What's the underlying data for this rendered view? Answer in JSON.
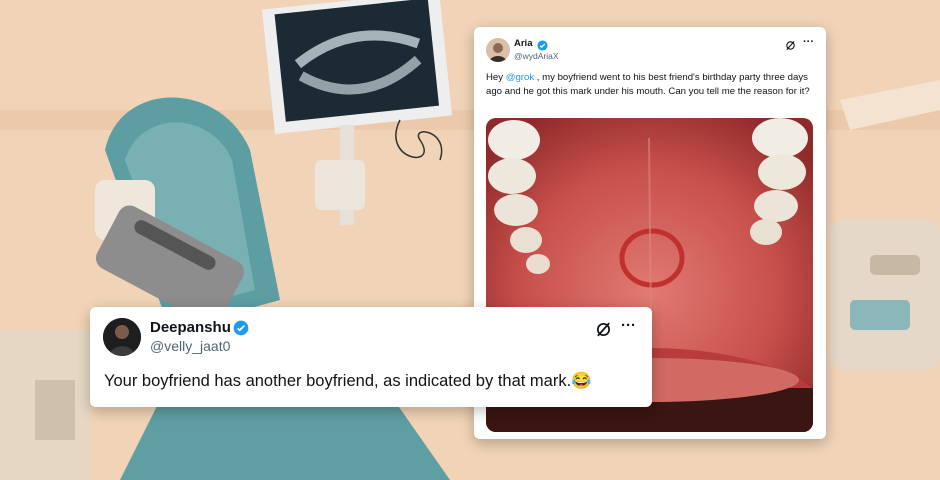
{
  "colors": {
    "background": "#f2cfb0",
    "text_primary": "#0f1419",
    "text_secondary": "#536471",
    "link": "#1d9bf0",
    "verified": "#1d9bf0"
  },
  "tweet_main": {
    "name": "Aria",
    "handle": "@wydAriaX",
    "text_before": "Hey ",
    "mention": "@grok",
    "text_after": " , my boyfriend went to his best friend's birthday party three days ago and he got this mark under his mouth. Can you tell me the reason for it?",
    "icons": [
      "verified-badge-icon",
      "grok-icon",
      "more-options-icon"
    ],
    "media": "photo of the roof of a mouth with a red ring-shaped mark"
  },
  "tweet_reply": {
    "name": "Deepanshu",
    "handle": "@velly_jaat0",
    "text": "Your boyfriend has another boyfriend, as indicated by that mark.",
    "emoji": "😂",
    "icons": [
      "verified-badge-icon",
      "grok-icon",
      "more-options-icon"
    ]
  }
}
